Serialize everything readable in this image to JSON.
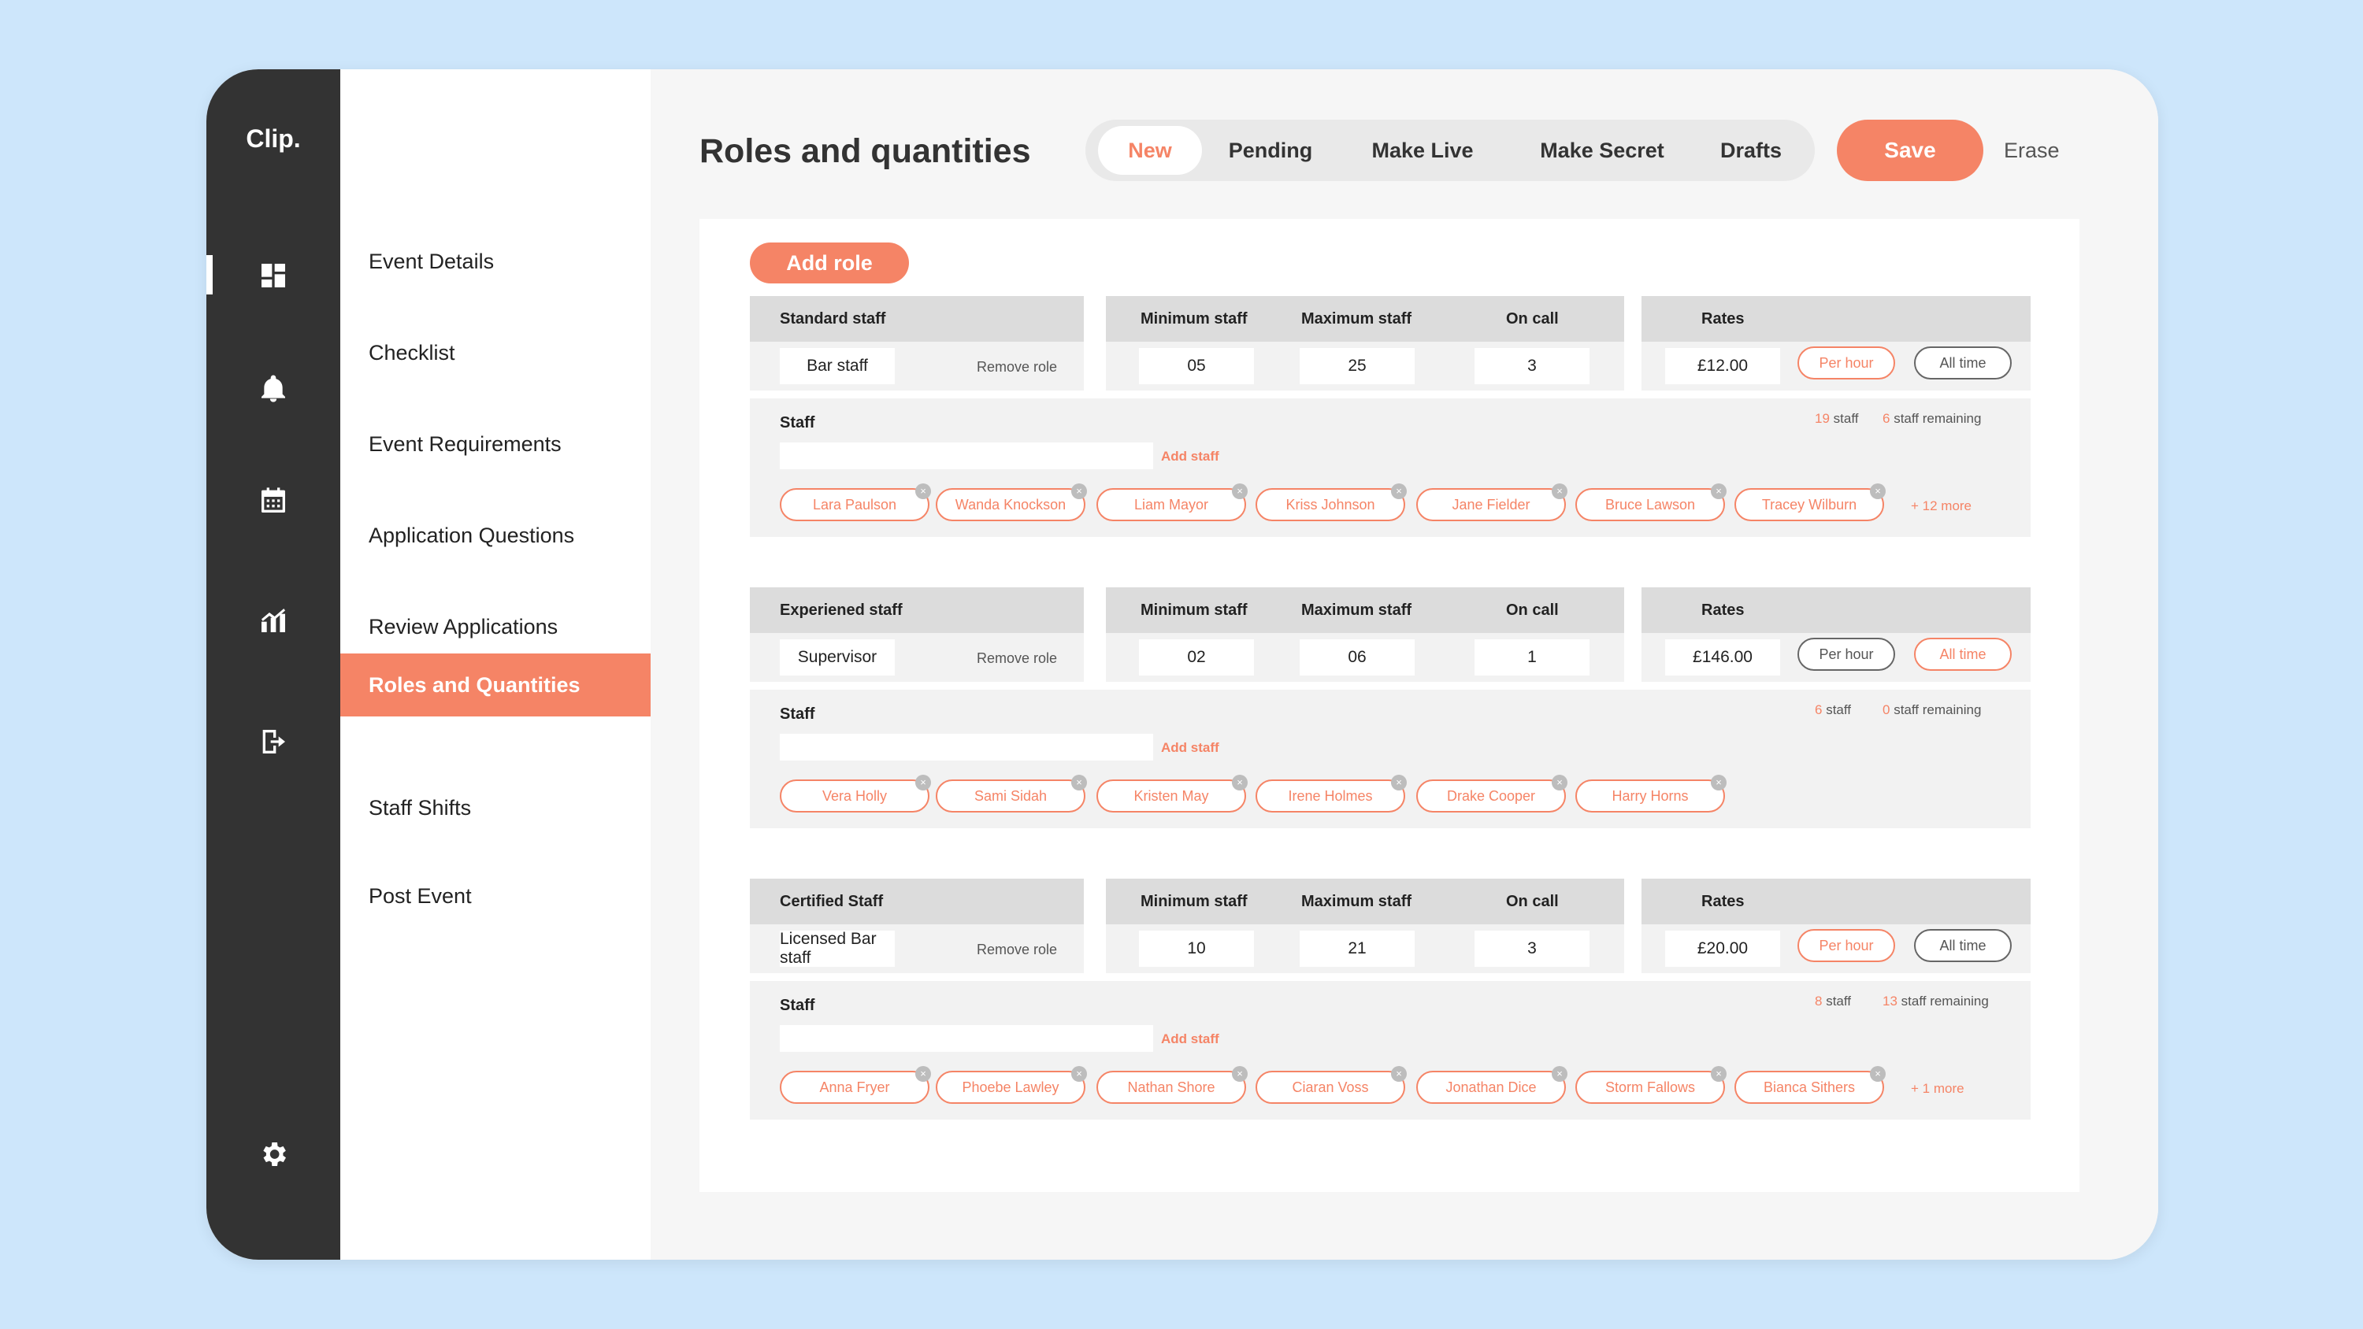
{
  "brand": {
    "logo": "Clip.",
    "accent": "#f58466"
  },
  "rail": {
    "icons": [
      "dashboard-icon",
      "bell-icon",
      "calendar-icon",
      "analytics-icon",
      "sign-out-icon",
      "gear-icon"
    ]
  },
  "menu": {
    "items": [
      {
        "label": "Event Details",
        "active": false
      },
      {
        "label": "Checklist",
        "active": false
      },
      {
        "label": "Event Requirements",
        "active": false
      },
      {
        "label": "Application Questions",
        "active": false
      },
      {
        "label": "Review Applications",
        "active": false
      },
      {
        "label": "Roles and Quantities",
        "active": true
      },
      {
        "label": "Staff Shifts",
        "active": false
      },
      {
        "label": "Post Event",
        "active": false
      }
    ]
  },
  "header": {
    "title": "Roles and quantities",
    "tabs": [
      {
        "label": "New",
        "active": true
      },
      {
        "label": "Pending",
        "active": false
      },
      {
        "label": "Make Live",
        "active": false
      },
      {
        "label": "Make Secret",
        "active": false
      },
      {
        "label": "Drafts",
        "active": false
      }
    ],
    "save_label": "Save",
    "erase_label": "Erase"
  },
  "content": {
    "add_role_label": "Add role",
    "labels": {
      "min_staff": "Minimum staff",
      "max_staff": "Maximum staff",
      "on_call": "On call",
      "rates": "Rates",
      "remove_role": "Remove role",
      "per_hour": "Per hour",
      "all_time": "All time",
      "staff": "Staff",
      "add_staff": "Add staff",
      "staff_word": "staff",
      "remaining_word": "staff remaining"
    },
    "roles": [
      {
        "category": "Standard staff",
        "role_name": "Bar staff",
        "min": "05",
        "max": "25",
        "on_call": "3",
        "rate": "£12.00",
        "rate_mode": "per_hour",
        "staff_count": "19",
        "remaining": "6",
        "members": [
          "Lara Paulson",
          "Wanda Knockson",
          "Liam Mayor",
          "Kriss Johnson",
          "Jane Fielder",
          "Bruce Lawson",
          "Tracey Wilburn"
        ],
        "more": "+ 12 more"
      },
      {
        "category": "Experiened staff",
        "role_name": "Supervisor",
        "min": "02",
        "max": "06",
        "on_call": "1",
        "rate": "£146.00",
        "rate_mode": "all_time",
        "staff_count": "6",
        "remaining": "0",
        "members": [
          "Vera Holly",
          "Sami Sidah",
          "Kristen May",
          "Irene Holmes",
          "Drake Cooper",
          "Harry Horns"
        ],
        "more": ""
      },
      {
        "category": "Certified Staff",
        "role_name": "Licensed Bar staff",
        "min": "10",
        "max": "21",
        "on_call": "3",
        "rate": "£20.00",
        "rate_mode": "per_hour",
        "staff_count": "8",
        "remaining": "13",
        "members": [
          "Anna Fryer",
          "Phoebe Lawley",
          "Nathan Shore",
          "Ciaran Voss",
          "Jonathan Dice",
          "Storm Fallows",
          "Bianca Sithers"
        ],
        "more": "+ 1 more"
      }
    ]
  }
}
